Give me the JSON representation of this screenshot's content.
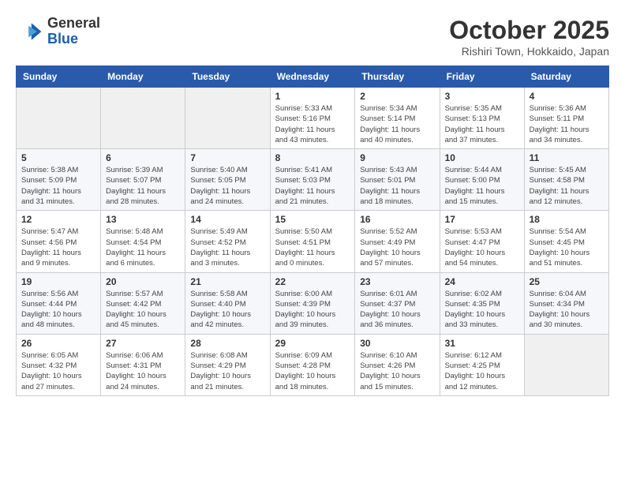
{
  "header": {
    "logo_general": "General",
    "logo_blue": "Blue",
    "month_title": "October 2025",
    "subtitle": "Rishiri Town, Hokkaido, Japan"
  },
  "weekdays": [
    "Sunday",
    "Monday",
    "Tuesday",
    "Wednesday",
    "Thursday",
    "Friday",
    "Saturday"
  ],
  "weeks": [
    [
      {
        "day": "",
        "info": ""
      },
      {
        "day": "",
        "info": ""
      },
      {
        "day": "",
        "info": ""
      },
      {
        "day": "1",
        "info": "Sunrise: 5:33 AM\nSunset: 5:16 PM\nDaylight: 11 hours\nand 43 minutes."
      },
      {
        "day": "2",
        "info": "Sunrise: 5:34 AM\nSunset: 5:14 PM\nDaylight: 11 hours\nand 40 minutes."
      },
      {
        "day": "3",
        "info": "Sunrise: 5:35 AM\nSunset: 5:13 PM\nDaylight: 11 hours\nand 37 minutes."
      },
      {
        "day": "4",
        "info": "Sunrise: 5:36 AM\nSunset: 5:11 PM\nDaylight: 11 hours\nand 34 minutes."
      }
    ],
    [
      {
        "day": "5",
        "info": "Sunrise: 5:38 AM\nSunset: 5:09 PM\nDaylight: 11 hours\nand 31 minutes."
      },
      {
        "day": "6",
        "info": "Sunrise: 5:39 AM\nSunset: 5:07 PM\nDaylight: 11 hours\nand 28 minutes."
      },
      {
        "day": "7",
        "info": "Sunrise: 5:40 AM\nSunset: 5:05 PM\nDaylight: 11 hours\nand 24 minutes."
      },
      {
        "day": "8",
        "info": "Sunrise: 5:41 AM\nSunset: 5:03 PM\nDaylight: 11 hours\nand 21 minutes."
      },
      {
        "day": "9",
        "info": "Sunrise: 5:43 AM\nSunset: 5:01 PM\nDaylight: 11 hours\nand 18 minutes."
      },
      {
        "day": "10",
        "info": "Sunrise: 5:44 AM\nSunset: 5:00 PM\nDaylight: 11 hours\nand 15 minutes."
      },
      {
        "day": "11",
        "info": "Sunrise: 5:45 AM\nSunset: 4:58 PM\nDaylight: 11 hours\nand 12 minutes."
      }
    ],
    [
      {
        "day": "12",
        "info": "Sunrise: 5:47 AM\nSunset: 4:56 PM\nDaylight: 11 hours\nand 9 minutes."
      },
      {
        "day": "13",
        "info": "Sunrise: 5:48 AM\nSunset: 4:54 PM\nDaylight: 11 hours\nand 6 minutes."
      },
      {
        "day": "14",
        "info": "Sunrise: 5:49 AM\nSunset: 4:52 PM\nDaylight: 11 hours\nand 3 minutes."
      },
      {
        "day": "15",
        "info": "Sunrise: 5:50 AM\nSunset: 4:51 PM\nDaylight: 11 hours\nand 0 minutes."
      },
      {
        "day": "16",
        "info": "Sunrise: 5:52 AM\nSunset: 4:49 PM\nDaylight: 10 hours\nand 57 minutes."
      },
      {
        "day": "17",
        "info": "Sunrise: 5:53 AM\nSunset: 4:47 PM\nDaylight: 10 hours\nand 54 minutes."
      },
      {
        "day": "18",
        "info": "Sunrise: 5:54 AM\nSunset: 4:45 PM\nDaylight: 10 hours\nand 51 minutes."
      }
    ],
    [
      {
        "day": "19",
        "info": "Sunrise: 5:56 AM\nSunset: 4:44 PM\nDaylight: 10 hours\nand 48 minutes."
      },
      {
        "day": "20",
        "info": "Sunrise: 5:57 AM\nSunset: 4:42 PM\nDaylight: 10 hours\nand 45 minutes."
      },
      {
        "day": "21",
        "info": "Sunrise: 5:58 AM\nSunset: 4:40 PM\nDaylight: 10 hours\nand 42 minutes."
      },
      {
        "day": "22",
        "info": "Sunrise: 6:00 AM\nSunset: 4:39 PM\nDaylight: 10 hours\nand 39 minutes."
      },
      {
        "day": "23",
        "info": "Sunrise: 6:01 AM\nSunset: 4:37 PM\nDaylight: 10 hours\nand 36 minutes."
      },
      {
        "day": "24",
        "info": "Sunrise: 6:02 AM\nSunset: 4:35 PM\nDaylight: 10 hours\nand 33 minutes."
      },
      {
        "day": "25",
        "info": "Sunrise: 6:04 AM\nSunset: 4:34 PM\nDaylight: 10 hours\nand 30 minutes."
      }
    ],
    [
      {
        "day": "26",
        "info": "Sunrise: 6:05 AM\nSunset: 4:32 PM\nDaylight: 10 hours\nand 27 minutes."
      },
      {
        "day": "27",
        "info": "Sunrise: 6:06 AM\nSunset: 4:31 PM\nDaylight: 10 hours\nand 24 minutes."
      },
      {
        "day": "28",
        "info": "Sunrise: 6:08 AM\nSunset: 4:29 PM\nDaylight: 10 hours\nand 21 minutes."
      },
      {
        "day": "29",
        "info": "Sunrise: 6:09 AM\nSunset: 4:28 PM\nDaylight: 10 hours\nand 18 minutes."
      },
      {
        "day": "30",
        "info": "Sunrise: 6:10 AM\nSunset: 4:26 PM\nDaylight: 10 hours\nand 15 minutes."
      },
      {
        "day": "31",
        "info": "Sunrise: 6:12 AM\nSunset: 4:25 PM\nDaylight: 10 hours\nand 12 minutes."
      },
      {
        "day": "",
        "info": ""
      }
    ]
  ]
}
